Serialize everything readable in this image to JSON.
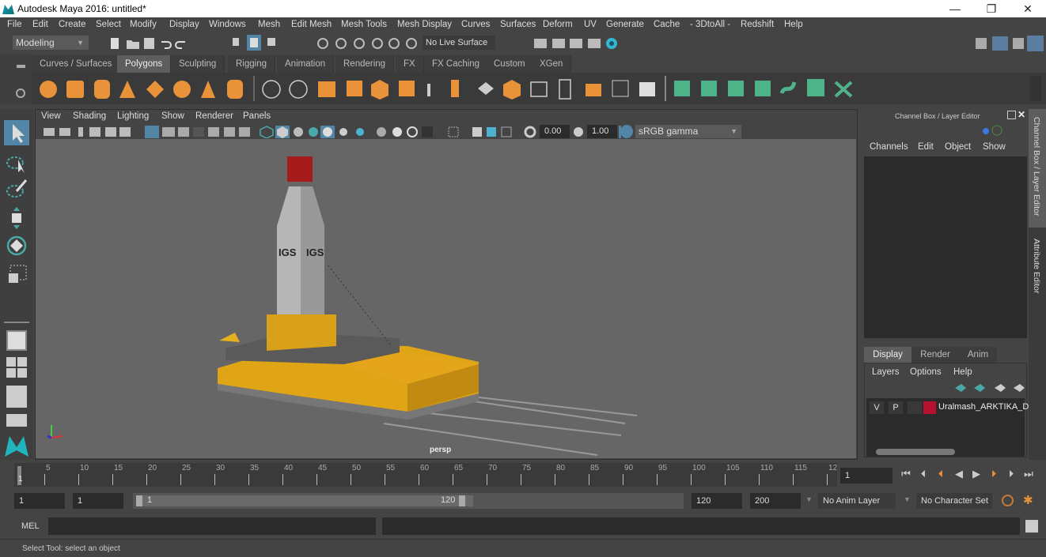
{
  "window": {
    "title": "Autodesk Maya 2016: untitled*",
    "minimize": "—",
    "maximize": "❐",
    "close": "✕"
  },
  "menubar": [
    "File",
    "Edit",
    "Create",
    "Select",
    "Modify",
    "Display",
    "Windows",
    "Mesh",
    "Edit Mesh",
    "Mesh Tools",
    "Mesh Display",
    "Curves",
    "Surfaces",
    "Deform",
    "UV",
    "Generate",
    "Cache",
    "- 3DtoAll -",
    "Redshift",
    "Help"
  ],
  "statusline": {
    "mode": "Modeling",
    "live_surface": "No Live Surface"
  },
  "shelf": {
    "tabs": [
      "Curves / Surfaces",
      "Polygons",
      "Sculpting",
      "Rigging",
      "Animation",
      "Rendering",
      "FX",
      "FX Caching",
      "Custom",
      "XGen"
    ],
    "active_tab": "Polygons"
  },
  "viewport": {
    "menu": [
      "View",
      "Shading",
      "Lighting",
      "Show",
      "Renderer",
      "Panels"
    ],
    "exposure": "0.00",
    "gamma": "1.00",
    "color_space": "sRGB gamma",
    "camera_label": "persp",
    "logo_text": "IGS"
  },
  "channel_box": {
    "title": "Channel Box / Layer Editor",
    "menu": [
      "Channels",
      "Edit",
      "Object",
      "Show"
    ]
  },
  "layer_editor": {
    "tabs": [
      "Display",
      "Render",
      "Anim"
    ],
    "active_tab": "Display",
    "menu": [
      "Layers",
      "Options",
      "Help"
    ],
    "layers": [
      {
        "v": "V",
        "p": "P",
        "color": "#b5112e",
        "name": "Uralmash_ARKTIKA_Dri"
      }
    ]
  },
  "side_tabs": [
    "Channel Box / Layer Editor",
    "Attribute Editor"
  ],
  "timeline": {
    "ticks": [
      "5",
      "10",
      "15",
      "20",
      "25",
      "30",
      "35",
      "40",
      "45",
      "50",
      "55",
      "60",
      "65",
      "70",
      "75",
      "80",
      "85",
      "90",
      "95",
      "100",
      "105",
      "110",
      "115",
      "12"
    ],
    "current_marker": "1",
    "current_frame": "1"
  },
  "range": {
    "start": "1",
    "playback_start": "1",
    "slider_start": "1",
    "slider_end": "120",
    "playback_end": "120",
    "end": "200",
    "anim_layer": "No Anim Layer",
    "character_set": "No Character Set"
  },
  "command_line": {
    "label": "MEL",
    "value": ""
  },
  "help_line": "Select Tool: select an object",
  "colors": {
    "accent": "#5285a6",
    "shelf_orange": "#e8923a",
    "shelf_green": "#4fb38a",
    "yellow": "#e5a51a",
    "teal": "#4ba8a8"
  }
}
